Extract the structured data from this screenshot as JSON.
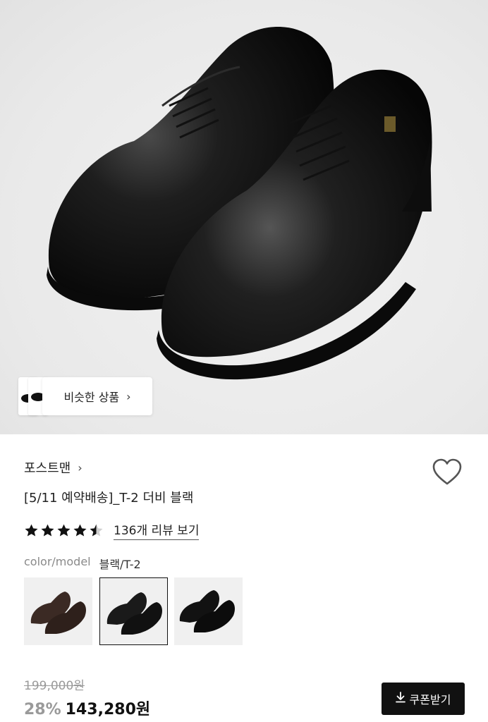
{
  "product_image": {
    "alt_icon": "shoe-image"
  },
  "similar": {
    "label": "비슷한 상품",
    "chevron": "›"
  },
  "brand": {
    "name": "포스트맨",
    "chevron": "›"
  },
  "title": "[5/11 예약배송]_T-2 더비 블랙",
  "rating": {
    "value": 4.5,
    "max": 5,
    "review_label": "136개 리뷰 보기"
  },
  "options": {
    "label": "color/model",
    "selected": "블랙/T-2",
    "swatches": [
      {
        "name": "brown",
        "color": "#3b2a24",
        "selected": false
      },
      {
        "name": "black",
        "color": "#1a1a1a",
        "selected": true
      },
      {
        "name": "black-alt",
        "color": "#121212",
        "selected": false
      }
    ]
  },
  "pricing": {
    "original": "199,000원",
    "discount": "28%",
    "price": "143,280원"
  },
  "coupon": {
    "label": "쿠폰받기",
    "icon": "download-icon"
  },
  "colors": {
    "accent": "#111111",
    "muted": "#9a9a9a"
  }
}
